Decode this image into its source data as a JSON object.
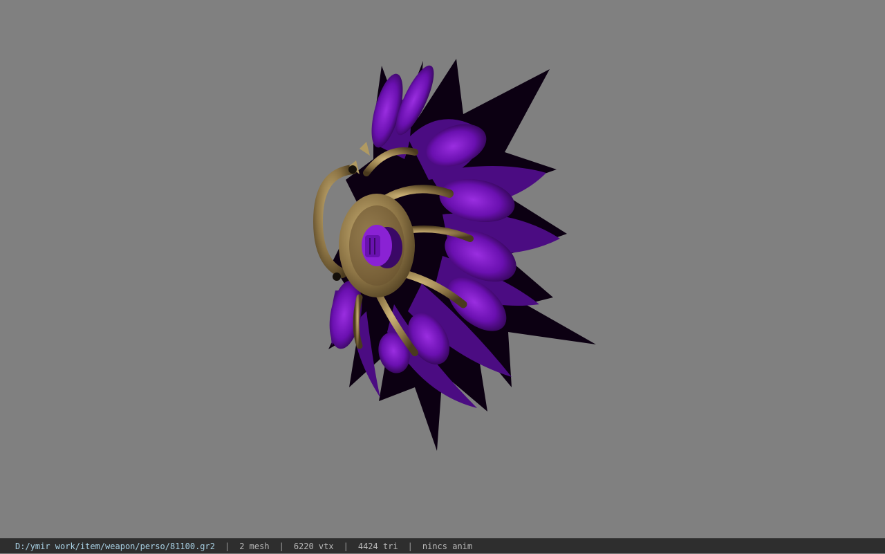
{
  "viewport": {
    "background": "#808080",
    "model_colors": {
      "outer_blade": "#0a0010",
      "mid_blade": "#3a0a64",
      "inner_blade": "#7a14c8",
      "gold_ornament": "#8a7444",
      "gold_highlight": "#c4a868"
    }
  },
  "status": {
    "path": "D:/ymir work/item/weapon/perso/81100.gr2",
    "separator": "|",
    "mesh": "2 mesh",
    "vtx": "6220 vtx",
    "tri": "4424 tri",
    "anim": "nincs anim"
  }
}
